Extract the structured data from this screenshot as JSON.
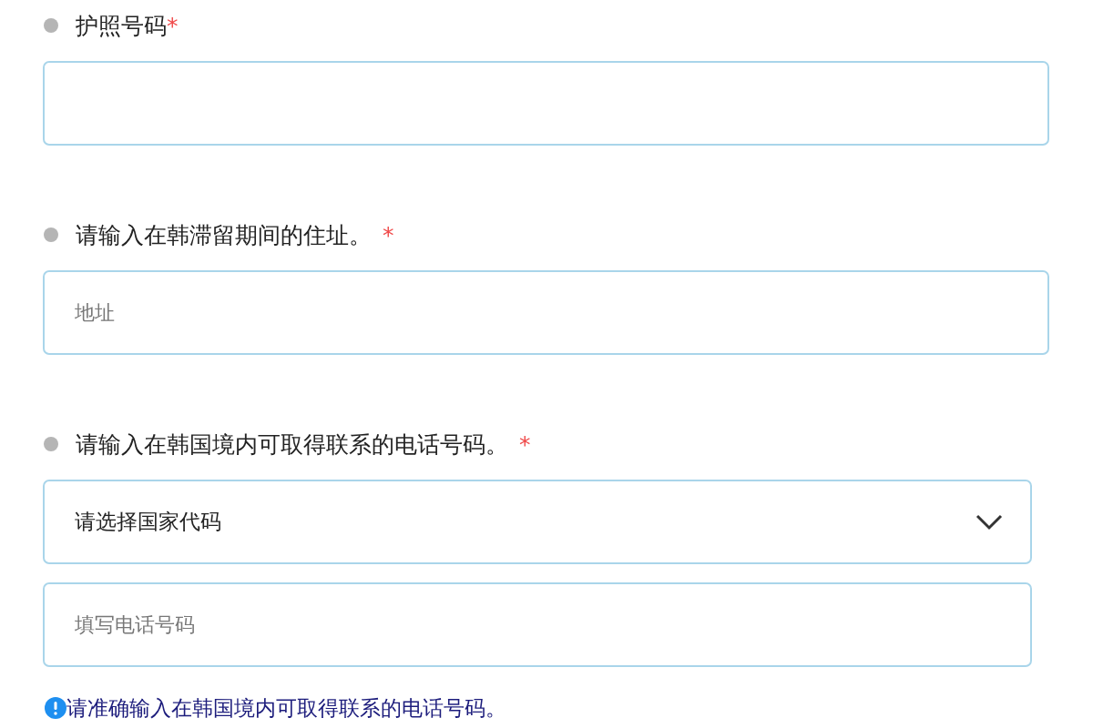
{
  "sections": [
    {
      "label": "护照号码",
      "required_mark": "*",
      "inputs": [
        {
          "kind": "text"
        }
      ]
    },
    {
      "label": "请输入在韩滞留期间的住址。",
      "required_mark": "*",
      "inputs": [
        {
          "kind": "text",
          "placeholder": "地址"
        }
      ]
    },
    {
      "label": "请输入在韩国境内可取得联系的电话号码。",
      "required_mark": "*",
      "inputs": [
        {
          "kind": "select",
          "value": "请选择国家代码"
        },
        {
          "kind": "text",
          "placeholder": "填写电话号码"
        }
      ],
      "note": "请准确输入在韩国境内可取得联系的电话号码。"
    }
  ]
}
